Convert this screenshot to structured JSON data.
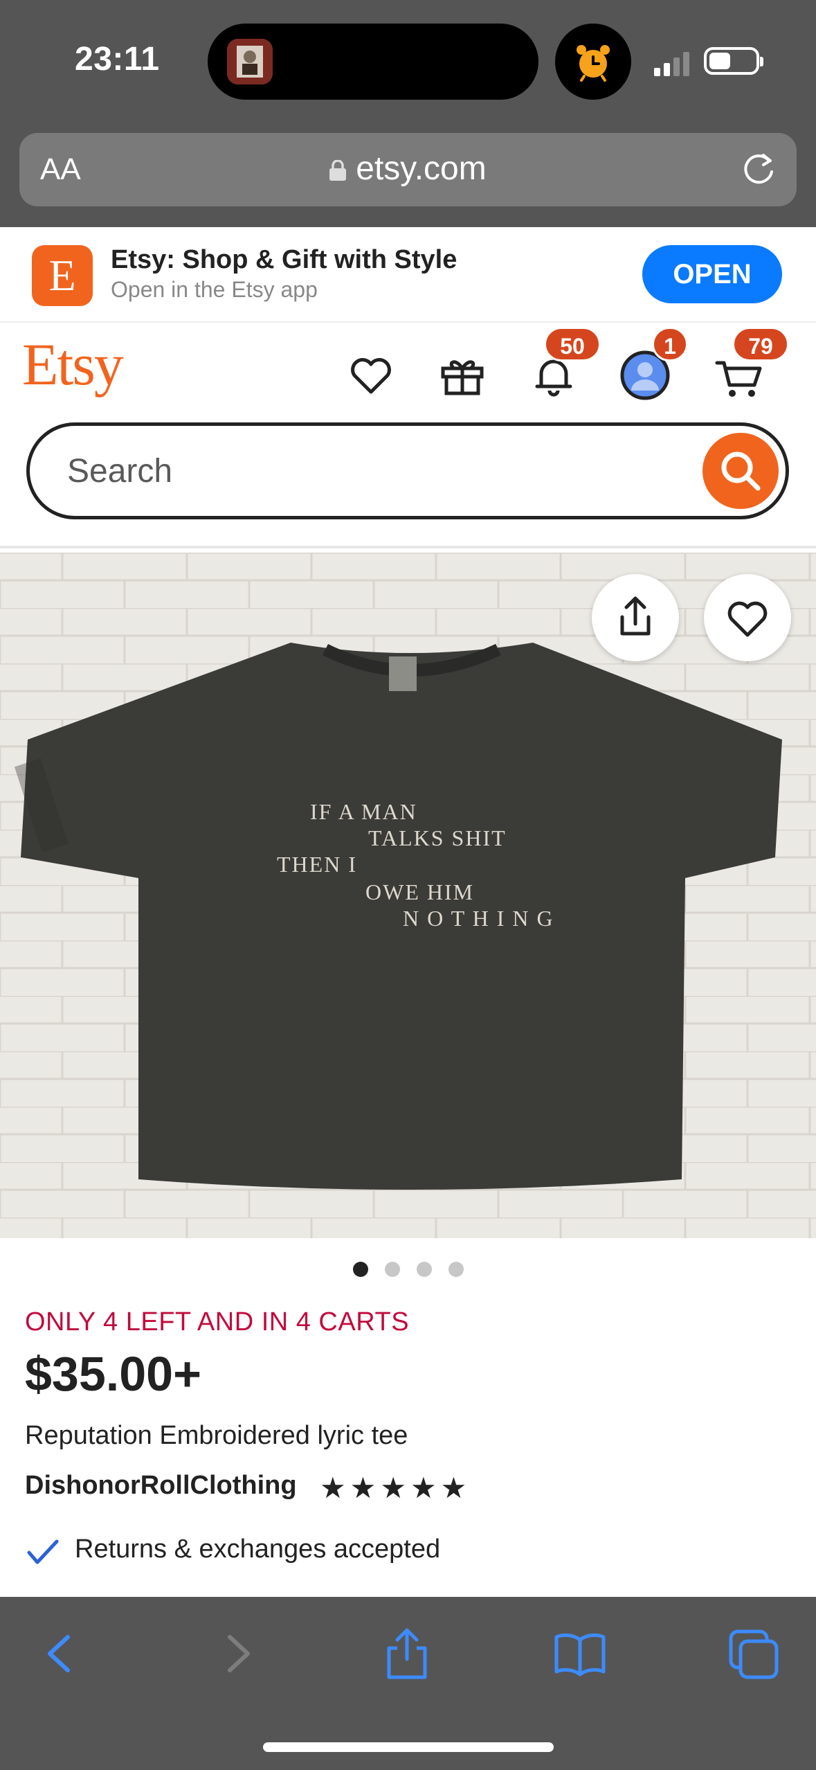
{
  "status_bar": {
    "time": "23:11"
  },
  "browser": {
    "aa_label": "AA",
    "url": "etsy.com"
  },
  "app_banner": {
    "icon_letter": "E",
    "title": "Etsy: Shop & Gift with Style",
    "subtitle": "Open in the Etsy app",
    "open_label": "OPEN"
  },
  "header": {
    "logo": "Etsy",
    "notifications_count": "50",
    "account_count": "1",
    "cart_count": "79",
    "search_placeholder": "Search"
  },
  "product_image": {
    "shirt_lines": [
      "IF A MAN",
      "TALKS SHIT",
      "THEN I",
      "OWE HIM",
      "N O T H I N G"
    ],
    "slide_count": 4,
    "active_slide": 1
  },
  "product": {
    "stock_notice": "ONLY 4 LEFT AND IN 4 CARTS",
    "price": "$35.00+",
    "title": "Reputation Embroidered lyric tee",
    "shop_name": "DishonorRollClothing",
    "rating_stars": 5,
    "returns_text": "Returns & exchanges accepted"
  },
  "colors": {
    "etsy_orange": "#f1641e",
    "stock_red": "#c20a3c",
    "ios_blue": "#0a7aff",
    "badge_red": "#d5461f",
    "toolbar_blue": "#3d8bff"
  }
}
